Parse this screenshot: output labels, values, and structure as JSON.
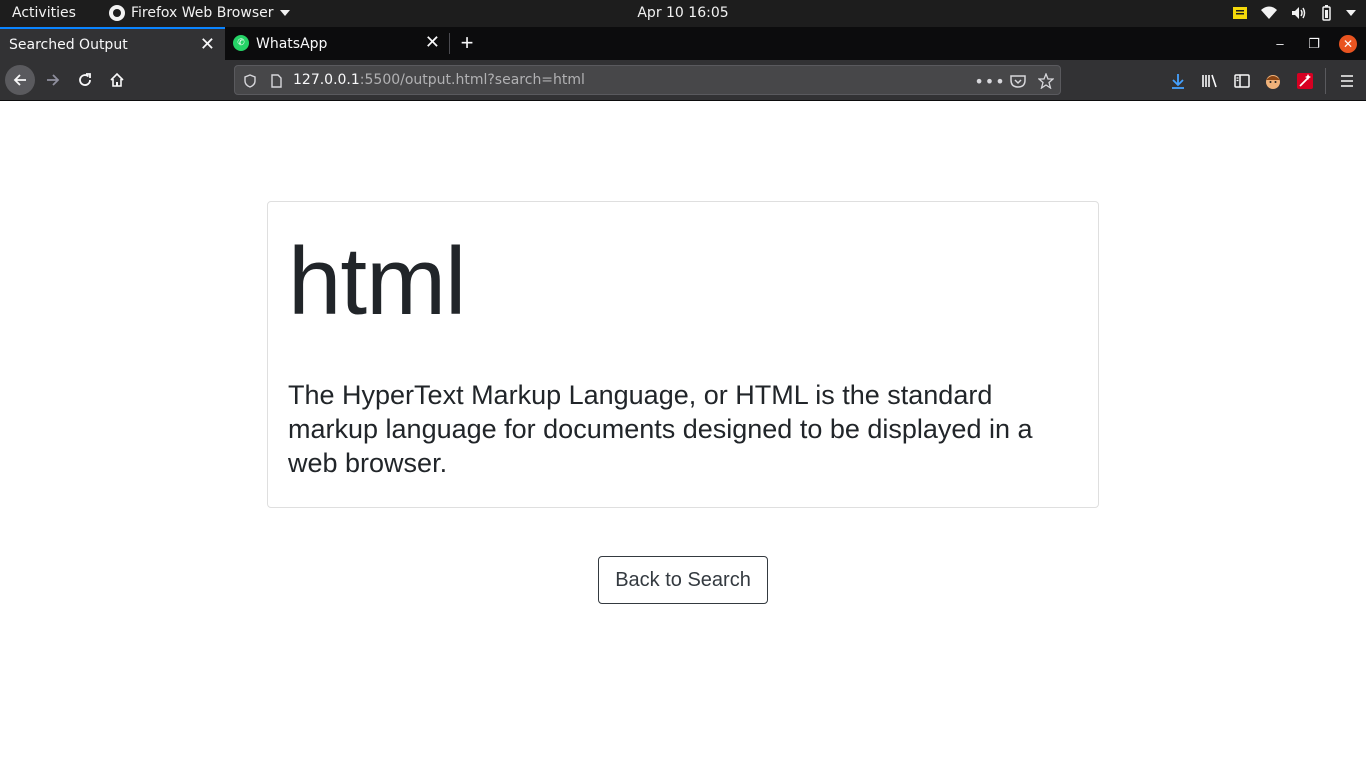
{
  "topbar": {
    "activities": "Activities",
    "app_name": "Firefox Web Browser",
    "clock": "Apr 10  16:05"
  },
  "tabs": [
    {
      "title": "Searched Output",
      "active": true
    },
    {
      "title": "WhatsApp",
      "active": false
    }
  ],
  "navbar": {
    "url_host": "127.0.0.1",
    "url_rest": ":5500/output.html?search=html"
  },
  "page": {
    "heading": "html",
    "description": "The HyperText Markup Language, or HTML is the standard markup language for documents designed to be displayed in a web browser.",
    "back_button": "Back to Search"
  },
  "colors": {
    "accent": "#0a84ff",
    "ubuntu_close": "#e95420",
    "whatsapp": "#25d366",
    "text": "#212529"
  }
}
